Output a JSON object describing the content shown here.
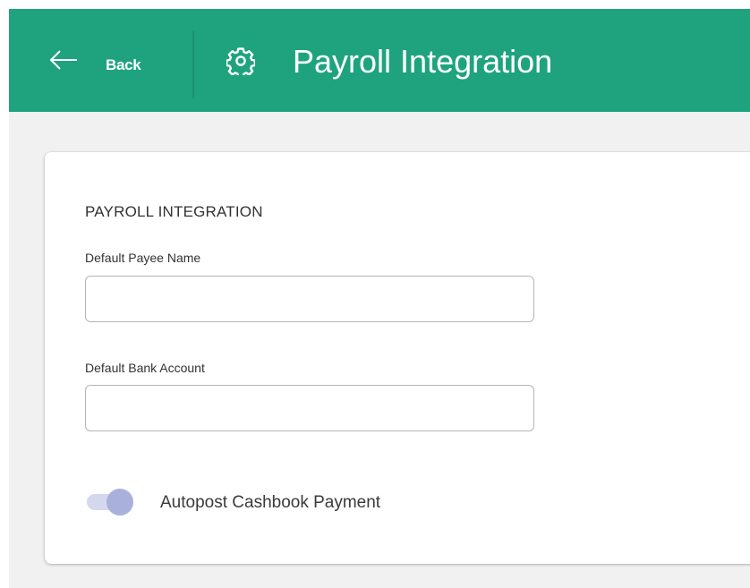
{
  "header": {
    "back_label": "Back",
    "title": "Payroll Integration",
    "background_color": "#1fa37f",
    "back_icon": "arrow-left-icon",
    "title_icon": "gear-icon"
  },
  "card": {
    "section_title": "PAYROLL INTEGRATION",
    "fields": [
      {
        "label": "Default Payee Name",
        "value": ""
      },
      {
        "label": "Default Bank Account",
        "value": ""
      }
    ],
    "toggle": {
      "label": "Autopost Cashbook Payment",
      "state": "on"
    }
  }
}
